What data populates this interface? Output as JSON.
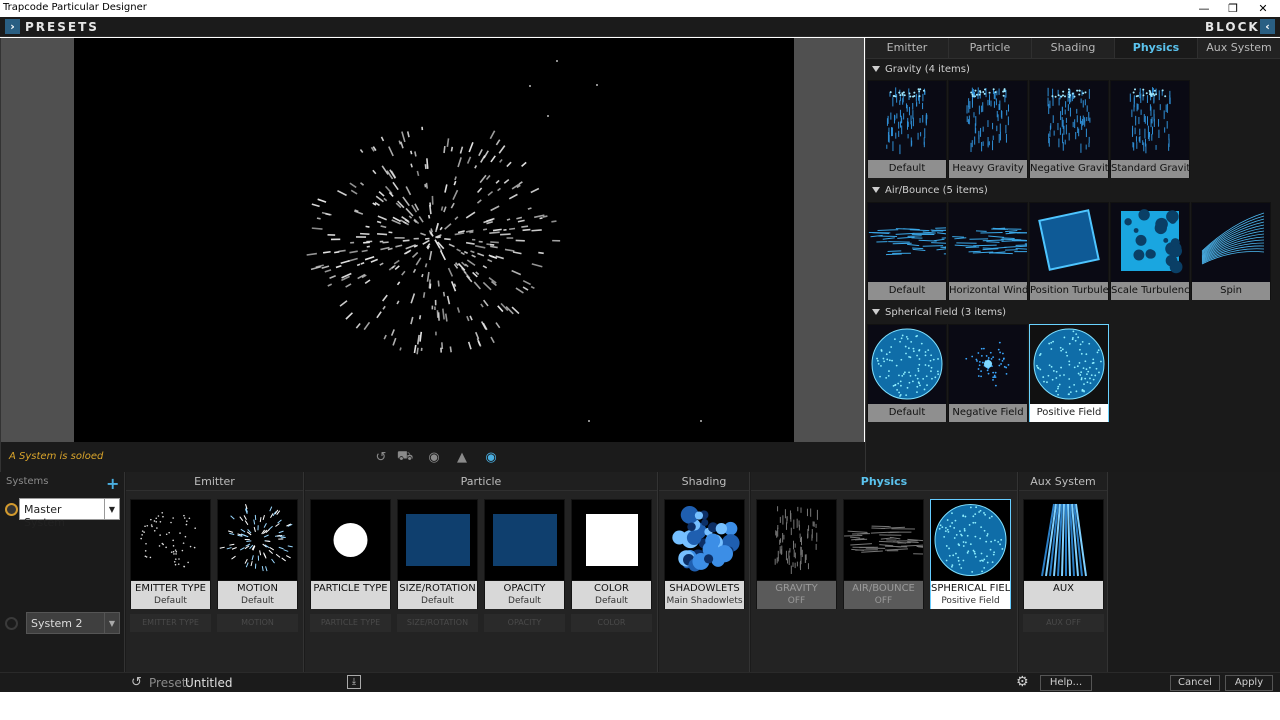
{
  "window": {
    "title": "Trapcode Particular Designer"
  },
  "header": {
    "presets_label": "PRESETS",
    "blocks_label": "BLOCKS"
  },
  "viewport": {
    "solo_message": "A System is soloed"
  },
  "blocks_panel": {
    "tabs": [
      "Emitter",
      "Particle",
      "Shading",
      "Physics",
      "Aux System"
    ],
    "active_tab": "Physics",
    "categories": [
      {
        "title": "Gravity  (4 items)",
        "items": [
          "Default",
          "Heavy Gravity",
          "Negative Gravity",
          "Standard Gravity"
        ]
      },
      {
        "title": "Air/Bounce  (5 items)",
        "items": [
          "Default",
          "Horizontal Wind",
          "Position Turbulence",
          "Scale Turbulence",
          "Spin"
        ]
      },
      {
        "title": "Spherical Field  (3 items)",
        "items": [
          "Default",
          "Negative Field",
          "Positive Field"
        ],
        "selected": "Positive Field"
      }
    ]
  },
  "systems": {
    "header": "Systems",
    "add_icon": "+",
    "list": [
      "Master System",
      "System 2"
    ]
  },
  "groups": {
    "emitter": "Emitter",
    "particle": "Particle",
    "shading": "Shading",
    "physics": "Physics",
    "aux": "Aux System"
  },
  "blocks": [
    {
      "name": "EMITTER TYPE",
      "sub": "Default",
      "ghost": "EMITTER TYPE"
    },
    {
      "name": "MOTION",
      "sub": "Default",
      "ghost": "MOTION"
    },
    {
      "name": "PARTICLE TYPE",
      "sub": "",
      "ghost": "PARTICLE TYPE"
    },
    {
      "name": "SIZE/ROTATION",
      "sub": "Default",
      "ghost": "SIZE/ROTATION"
    },
    {
      "name": "OPACITY",
      "sub": "Default",
      "ghost": "OPACITY"
    },
    {
      "name": "COLOR",
      "sub": "Default",
      "ghost": "COLOR"
    },
    {
      "name": "SHADOWLETS",
      "sub": "Main Shadowlets",
      "ghost": ""
    },
    {
      "name": "GRAVITY",
      "sub": "OFF",
      "ghost": ""
    },
    {
      "name": "AIR/BOUNCE",
      "sub": "OFF",
      "ghost": ""
    },
    {
      "name": "SPHERICAL FIELD",
      "sub": "Positive Field",
      "ghost": ""
    },
    {
      "name": "AUX",
      "sub": "",
      "ghost": "AUX OFF"
    }
  ],
  "footer": {
    "preset_label": "Preset:",
    "preset_name": "Untitled",
    "help_label": "Help...",
    "cancel_label": "Cancel",
    "apply_label": "Apply"
  },
  "colors": {
    "accent": "#5bc3ee",
    "solo": "#d9a42b"
  }
}
